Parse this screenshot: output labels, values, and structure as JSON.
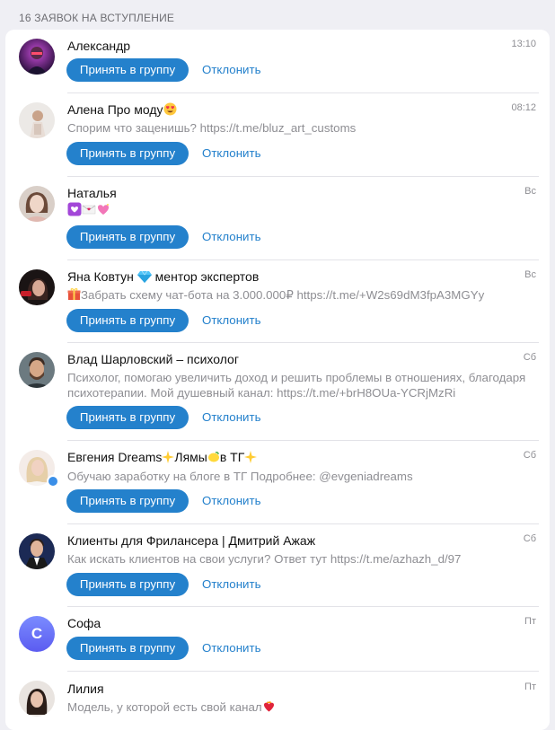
{
  "header": {
    "title": "16 ЗАЯВОК НА ВСТУПЛЕНИЕ"
  },
  "buttons": {
    "accept": "Принять в группу",
    "decline": "Отклонить"
  },
  "requests": [
    {
      "name": "Александр",
      "time": "13:10",
      "message": "",
      "avatar": "photo"
    },
    {
      "name": "Алена Про моду",
      "name_emoji": "heart-eyes-emoji",
      "time": "08:12",
      "message": "Спорим что заценишь? https://t.me/bluz_art_customs",
      "avatar": "photo"
    },
    {
      "name": "Наталья",
      "time": "Вс",
      "message": "",
      "message_emojis": [
        "purple-heart-emoji",
        "love-letter-emoji",
        "sparkling-heart-emoji"
      ],
      "avatar": "photo"
    },
    {
      "name": "Яна Ковтун",
      "name_suffix": "ментор экспертов",
      "time": "Вс",
      "message": "Забрать схему чат-бота на 3.000.000₽ https://t.me/+W2s69dM3fpA3MGYy",
      "avatar": "photo"
    },
    {
      "name": "Влад Шарловский – психолог",
      "time": "Сб",
      "message": "Психолог, помогаю увеличить доход и решить проблемы в отношениях, благодаря психотерапии. Мой душевный канал: https://t.me/+brH8OUa-YCRjMzRi",
      "avatar": "photo"
    },
    {
      "name": "Евгения Dreams",
      "name_mid": "Лямы",
      "name_end": "в ТГ",
      "time": "Сб",
      "message": "Обучаю заработку на блоге в ТГ Подробнее: @evgeniadreams",
      "avatar": "photo"
    },
    {
      "name": "Клиенты для Фрилансера | Дмитрий Ажаж",
      "time": "Сб",
      "message": "Как искать клиентов на свои услуги? Ответ тут https://t.me/azhazh_d/97",
      "avatar": "photo"
    },
    {
      "name": "Софа",
      "time": "Пт",
      "message": "",
      "avatar": "letter",
      "letter": "С"
    },
    {
      "name": "Лилия",
      "time": "Пт",
      "message": "Модель, у которой есть свой канал",
      "avatar": "photo"
    }
  ],
  "colors": {
    "accent": "#2481cc",
    "background": "#efeff4",
    "card": "#ffffff",
    "muted": "#8e8e93"
  }
}
